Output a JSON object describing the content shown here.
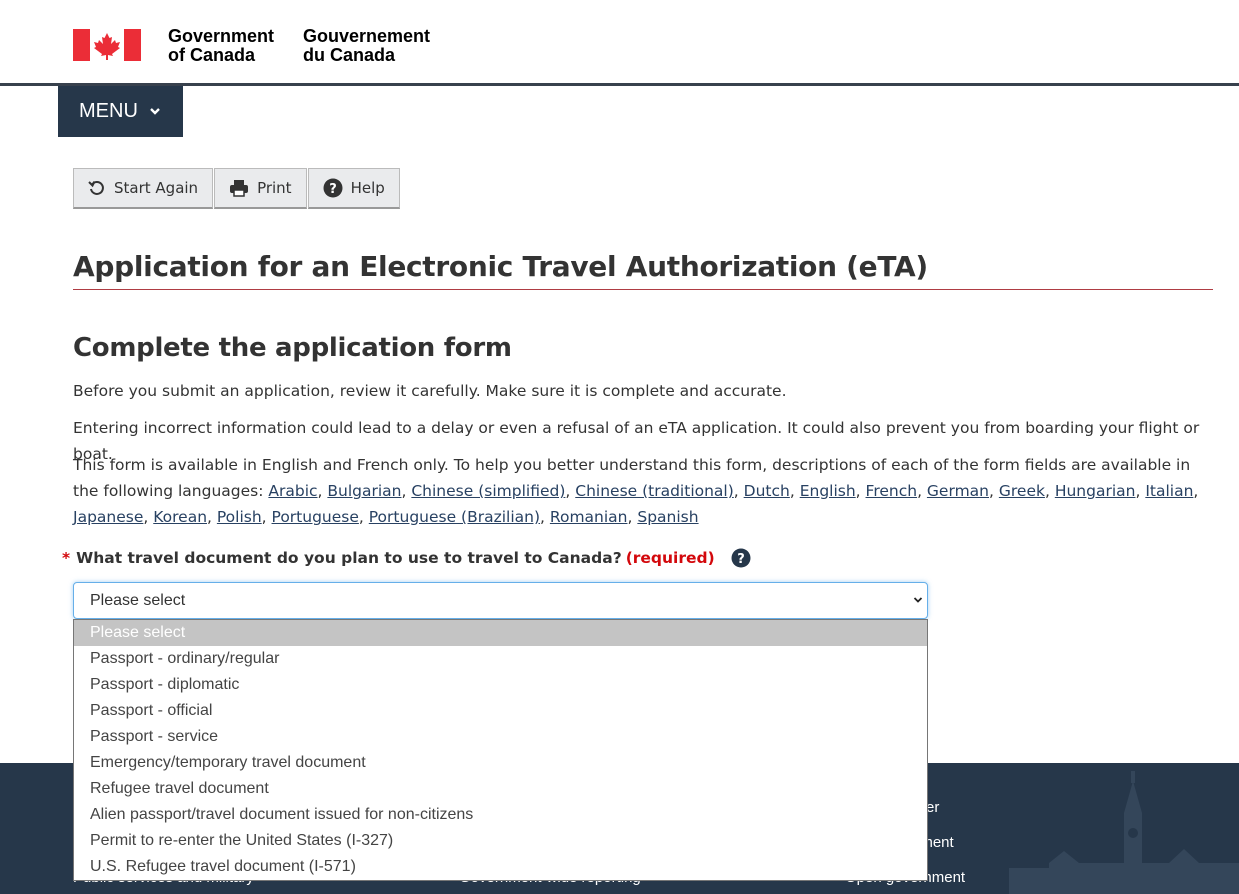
{
  "header": {
    "signature_en_line1": "Government",
    "signature_en_line2": "of Canada",
    "signature_fr_line1": "Gouvernement",
    "signature_fr_line2": "du Canada",
    "menu_label": "MENU"
  },
  "toolbar": {
    "start_again": "Start Again",
    "print": "Print",
    "help": "Help"
  },
  "page": {
    "title": "Application for an Electronic Travel Authorization (eTA)",
    "subtitle": "Complete the application form",
    "para1": "Before you submit an application, review it carefully. Make sure it is complete and accurate.",
    "para2": "Entering incorrect information could lead to a delay or even a refusal of an eTA application. It could also prevent you from boarding your flight or boat.",
    "para3_intro": "This form is available in English and French only. To help you better understand this form, descriptions of each of the form fields are available in the following languages: ",
    "languages": [
      "Arabic",
      "Bulgarian",
      "Chinese (simplified)",
      "Chinese (traditional)",
      "Dutch",
      "English",
      "French",
      "German",
      "Greek",
      "Hungarian",
      "Italian",
      "Japanese",
      "Korean",
      "Polish",
      "Portuguese",
      "Portuguese (Brazilian)",
      "Romanian",
      "Spanish"
    ]
  },
  "question": {
    "star": "*",
    "label": "What travel document do you plan to use to travel to Canada?",
    "required": "(required)",
    "selected_value": "Please select"
  },
  "options": [
    "Please select",
    "Passport - ordinary/regular",
    "Passport - diplomatic",
    "Passport - official",
    "Passport - service",
    "Emergency/temporary travel document",
    "Refugee travel document",
    "Alien passport/travel document issued for non-citizens",
    "Permit to re-enter the United States (I-327)",
    "U.S. Refugee travel document (I-571)"
  ],
  "footer": {
    "partial_link_1": "er",
    "partial_link_2": "nment",
    "partial_link_3": "ment",
    "partial_link_4": "Public services and military",
    "partial_link_5": "Government-wide reporting",
    "partial_link_6": "Open government"
  },
  "colors": {
    "header_rule": "#38414d",
    "menu_bg": "#26374a",
    "footer_bg": "#26374a",
    "link": "#284162",
    "required": "#d3080c",
    "title_rule": "#af3c43",
    "focus_border": "#66afe9"
  }
}
